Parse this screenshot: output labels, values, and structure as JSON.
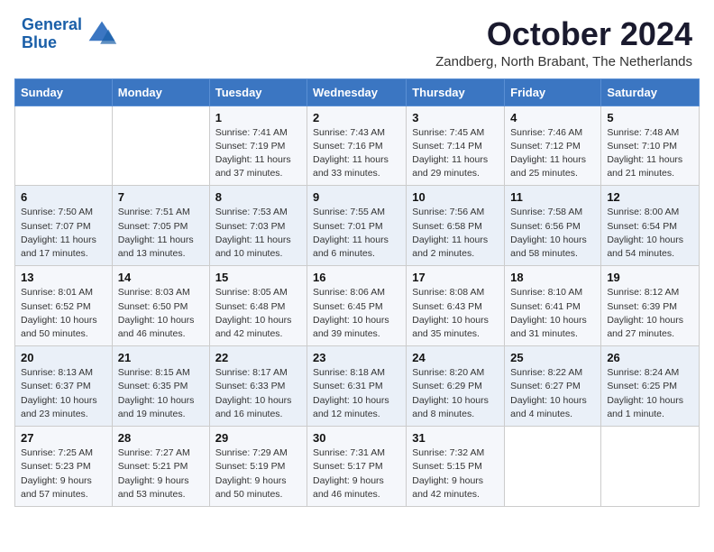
{
  "header": {
    "logo_line1": "General",
    "logo_line2": "Blue",
    "month_title": "October 2024",
    "location": "Zandberg, North Brabant, The Netherlands"
  },
  "days_of_week": [
    "Sunday",
    "Monday",
    "Tuesday",
    "Wednesday",
    "Thursday",
    "Friday",
    "Saturday"
  ],
  "weeks": [
    [
      {
        "day": "",
        "detail": ""
      },
      {
        "day": "",
        "detail": ""
      },
      {
        "day": "1",
        "detail": "Sunrise: 7:41 AM\nSunset: 7:19 PM\nDaylight: 11 hours and 37 minutes."
      },
      {
        "day": "2",
        "detail": "Sunrise: 7:43 AM\nSunset: 7:16 PM\nDaylight: 11 hours and 33 minutes."
      },
      {
        "day": "3",
        "detail": "Sunrise: 7:45 AM\nSunset: 7:14 PM\nDaylight: 11 hours and 29 minutes."
      },
      {
        "day": "4",
        "detail": "Sunrise: 7:46 AM\nSunset: 7:12 PM\nDaylight: 11 hours and 25 minutes."
      },
      {
        "day": "5",
        "detail": "Sunrise: 7:48 AM\nSunset: 7:10 PM\nDaylight: 11 hours and 21 minutes."
      }
    ],
    [
      {
        "day": "6",
        "detail": "Sunrise: 7:50 AM\nSunset: 7:07 PM\nDaylight: 11 hours and 17 minutes."
      },
      {
        "day": "7",
        "detail": "Sunrise: 7:51 AM\nSunset: 7:05 PM\nDaylight: 11 hours and 13 minutes."
      },
      {
        "day": "8",
        "detail": "Sunrise: 7:53 AM\nSunset: 7:03 PM\nDaylight: 11 hours and 10 minutes."
      },
      {
        "day": "9",
        "detail": "Sunrise: 7:55 AM\nSunset: 7:01 PM\nDaylight: 11 hours and 6 minutes."
      },
      {
        "day": "10",
        "detail": "Sunrise: 7:56 AM\nSunset: 6:58 PM\nDaylight: 11 hours and 2 minutes."
      },
      {
        "day": "11",
        "detail": "Sunrise: 7:58 AM\nSunset: 6:56 PM\nDaylight: 10 hours and 58 minutes."
      },
      {
        "day": "12",
        "detail": "Sunrise: 8:00 AM\nSunset: 6:54 PM\nDaylight: 10 hours and 54 minutes."
      }
    ],
    [
      {
        "day": "13",
        "detail": "Sunrise: 8:01 AM\nSunset: 6:52 PM\nDaylight: 10 hours and 50 minutes."
      },
      {
        "day": "14",
        "detail": "Sunrise: 8:03 AM\nSunset: 6:50 PM\nDaylight: 10 hours and 46 minutes."
      },
      {
        "day": "15",
        "detail": "Sunrise: 8:05 AM\nSunset: 6:48 PM\nDaylight: 10 hours and 42 minutes."
      },
      {
        "day": "16",
        "detail": "Sunrise: 8:06 AM\nSunset: 6:45 PM\nDaylight: 10 hours and 39 minutes."
      },
      {
        "day": "17",
        "detail": "Sunrise: 8:08 AM\nSunset: 6:43 PM\nDaylight: 10 hours and 35 minutes."
      },
      {
        "day": "18",
        "detail": "Sunrise: 8:10 AM\nSunset: 6:41 PM\nDaylight: 10 hours and 31 minutes."
      },
      {
        "day": "19",
        "detail": "Sunrise: 8:12 AM\nSunset: 6:39 PM\nDaylight: 10 hours and 27 minutes."
      }
    ],
    [
      {
        "day": "20",
        "detail": "Sunrise: 8:13 AM\nSunset: 6:37 PM\nDaylight: 10 hours and 23 minutes."
      },
      {
        "day": "21",
        "detail": "Sunrise: 8:15 AM\nSunset: 6:35 PM\nDaylight: 10 hours and 19 minutes."
      },
      {
        "day": "22",
        "detail": "Sunrise: 8:17 AM\nSunset: 6:33 PM\nDaylight: 10 hours and 16 minutes."
      },
      {
        "day": "23",
        "detail": "Sunrise: 8:18 AM\nSunset: 6:31 PM\nDaylight: 10 hours and 12 minutes."
      },
      {
        "day": "24",
        "detail": "Sunrise: 8:20 AM\nSunset: 6:29 PM\nDaylight: 10 hours and 8 minutes."
      },
      {
        "day": "25",
        "detail": "Sunrise: 8:22 AM\nSunset: 6:27 PM\nDaylight: 10 hours and 4 minutes."
      },
      {
        "day": "26",
        "detail": "Sunrise: 8:24 AM\nSunset: 6:25 PM\nDaylight: 10 hours and 1 minute."
      }
    ],
    [
      {
        "day": "27",
        "detail": "Sunrise: 7:25 AM\nSunset: 5:23 PM\nDaylight: 9 hours and 57 minutes."
      },
      {
        "day": "28",
        "detail": "Sunrise: 7:27 AM\nSunset: 5:21 PM\nDaylight: 9 hours and 53 minutes."
      },
      {
        "day": "29",
        "detail": "Sunrise: 7:29 AM\nSunset: 5:19 PM\nDaylight: 9 hours and 50 minutes."
      },
      {
        "day": "30",
        "detail": "Sunrise: 7:31 AM\nSunset: 5:17 PM\nDaylight: 9 hours and 46 minutes."
      },
      {
        "day": "31",
        "detail": "Sunrise: 7:32 AM\nSunset: 5:15 PM\nDaylight: 9 hours and 42 minutes."
      },
      {
        "day": "",
        "detail": ""
      },
      {
        "day": "",
        "detail": ""
      }
    ]
  ]
}
